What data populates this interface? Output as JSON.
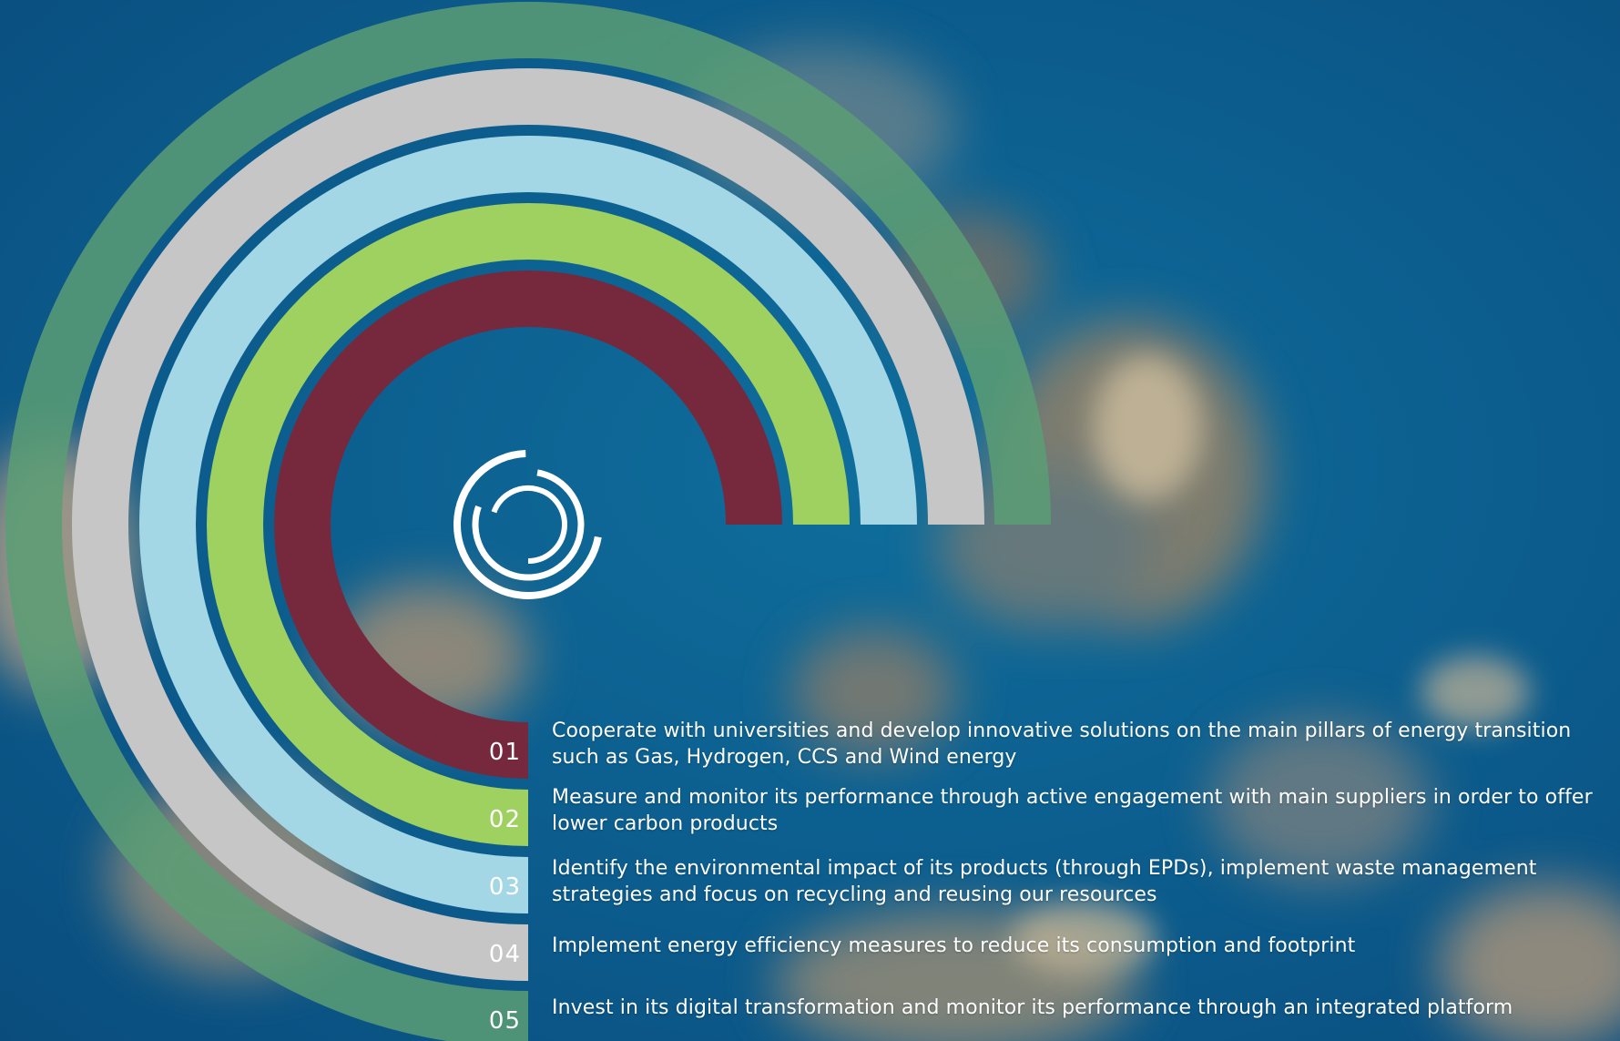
{
  "colors": {
    "ocean": "#0b5c8e",
    "band_05": "#5a9e74",
    "band_04": "#c6c6c6",
    "band_03": "#a3d7e6",
    "band_02": "#9fd161",
    "band_01": "#76293d",
    "text": "#ffffff"
  },
  "logo": {
    "icon": "concentric-rings-logo-icon"
  },
  "pillars": [
    {
      "number": "01",
      "text": "Cooperate with universities and develop innovative solutions on the main pillars of energy transition such as Gas, Hydrogen, CCS and Wind energy"
    },
    {
      "number": "02",
      "text": "Measure and monitor its performance through active engagement with main suppliers in order to offer lower carbon products"
    },
    {
      "number": "03",
      "text": "Identify the environmental impact of its products (through EPDs), implement waste management strategies and focus on recycling and reusing our resources"
    },
    {
      "number": "04",
      "text": "Implement energy efficiency measures to reduce its consumption and footprint"
    },
    {
      "number": "05",
      "text": "Invest in its digital transformation and monitor its performance through an integrated platform"
    }
  ]
}
